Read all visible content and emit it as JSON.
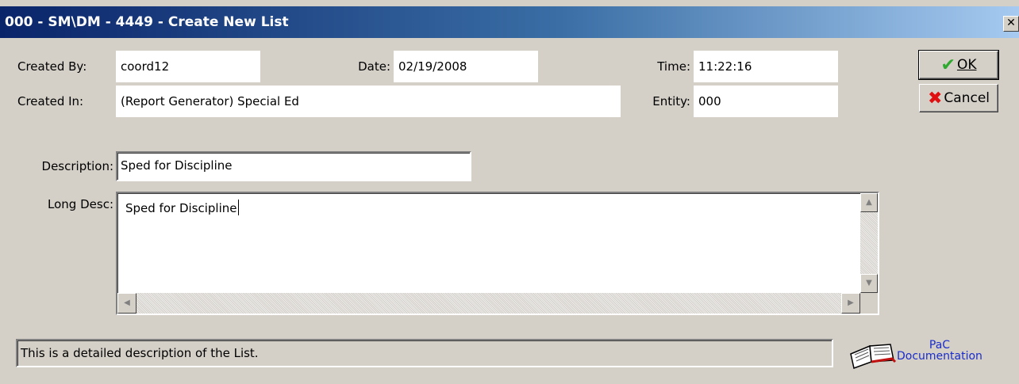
{
  "window": {
    "title": "000 - SM\\DM - 4449 - Create New List",
    "close_glyph": "✕"
  },
  "header": {
    "created_by_label": "Created By:",
    "created_by_value": "coord12",
    "date_label": "Date:",
    "date_value": "02/19/2008",
    "time_label": "Time:",
    "time_value": "11:22:16",
    "created_in_label": "Created In:",
    "created_in_value": "(Report Generator) Special Ed",
    "entity_label": "Entity:",
    "entity_value": "000"
  },
  "form": {
    "description_label": "Description:",
    "description_value": "Sped for Discipline",
    "long_desc_label": "Long Desc:",
    "long_desc_value": "Sped for Discipline"
  },
  "buttons": {
    "ok_label": "OK",
    "ok_icon": "check-icon",
    "ok_icon_color": "#2fa82f",
    "cancel_label": "Cancel",
    "cancel_icon": "x-icon",
    "cancel_icon_color": "#e01010"
  },
  "status": {
    "text": "This is a detailed description of the List."
  },
  "pac": {
    "line1": "PaC",
    "line2": "Documentation",
    "icon": "book-icon",
    "color": "#1a2cc9"
  }
}
